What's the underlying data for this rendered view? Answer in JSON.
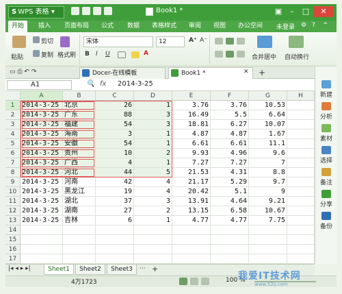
{
  "app": {
    "name": "WPS 表格",
    "document_title": "Book1 *",
    "accent_color": "#3f9e3a"
  },
  "menu": {
    "tabs": [
      "开始",
      "插入",
      "页面布局",
      "公式",
      "数据",
      "表格样式",
      "审阅",
      "视图",
      "办公空间"
    ],
    "active_tab": "开始",
    "login": "未登录"
  },
  "ribbon": {
    "paste": "粘贴",
    "cut": "剪切",
    "copy": "复制",
    "format_painter": "格式刷",
    "font_name": "宋体",
    "font_size": "12",
    "merge_center": "合并居中",
    "wrap_text": "自动换行"
  },
  "doc_tabs": [
    {
      "label": "Docer-在线模板"
    },
    {
      "label": "Book1 *"
    }
  ],
  "formula_bar": {
    "name_box": "A1",
    "fx": "fx",
    "content": "2014-3-25"
  },
  "grid": {
    "columns": [
      "A",
      "B",
      "C",
      "D",
      "E",
      "F",
      "G",
      "H"
    ],
    "rows": [
      [
        "2014-3-25",
        "北京",
        "26",
        "1",
        "3.76",
        "3.76",
        "10.53"
      ],
      [
        "2014-3-25",
        "广东",
        "88",
        "3",
        "16.49",
        "5.5",
        "6.64"
      ],
      [
        "2014-3-25",
        "福建",
        "54",
        "3",
        "18.81",
        "6.27",
        "10.07"
      ],
      [
        "2014-3-25",
        "海南",
        "3",
        "1",
        "4.87",
        "4.87",
        "1.67"
      ],
      [
        "2014-3-25",
        "安徽",
        "54",
        "1",
        "6.61",
        "6.61",
        "11.1"
      ],
      [
        "2014-3-25",
        "贵州",
        "10",
        "2",
        "9.93",
        "4.96",
        "9.6"
      ],
      [
        "2014-3-25",
        "广西",
        "4",
        "1",
        "7.27",
        "7.27",
        "7"
      ],
      [
        "2014-3-25",
        "河北",
        "44",
        "5",
        "21.53",
        "4.31",
        "8.8"
      ],
      [
        "2014-3-25",
        "河南",
        "42",
        "4",
        "21.17",
        "5.29",
        "9.7"
      ],
      [
        "2014-3-25",
        "黑龙江",
        "19",
        "4",
        "20.42",
        "5.1",
        "9"
      ],
      [
        "2014-3-25",
        "湖北",
        "37",
        "3",
        "13.91",
        "4.64",
        "9.21"
      ],
      [
        "2014-3-25",
        "湖南",
        "27",
        "2",
        "13.15",
        "6.58",
        "10.67"
      ],
      [
        "2014-3-25",
        "吉林",
        "6",
        "1",
        "4.77",
        "4.77",
        "7.75"
      ],
      [
        "",
        "",
        "",
        "",
        "",
        "",
        ""
      ],
      [
        "",
        "",
        "",
        "",
        "",
        "",
        ""
      ],
      [
        "",
        "",
        "",
        "",
        "",
        "",
        ""
      ],
      [
        "",
        "",
        "",
        "",
        "",
        "",
        ""
      ]
    ]
  },
  "right_panel": [
    "新建",
    "分析",
    "素材",
    "选择",
    "备注",
    "分享",
    "备份"
  ],
  "sheets": [
    "Sheet1",
    "Sheet2",
    "Sheet3"
  ],
  "active_sheet": "Sheet1",
  "status": {
    "sum": "4万1723",
    "zoom": "100 %"
  },
  "watermark": {
    "text": "我爱IT技术网",
    "sub": "www.52ij.com"
  }
}
